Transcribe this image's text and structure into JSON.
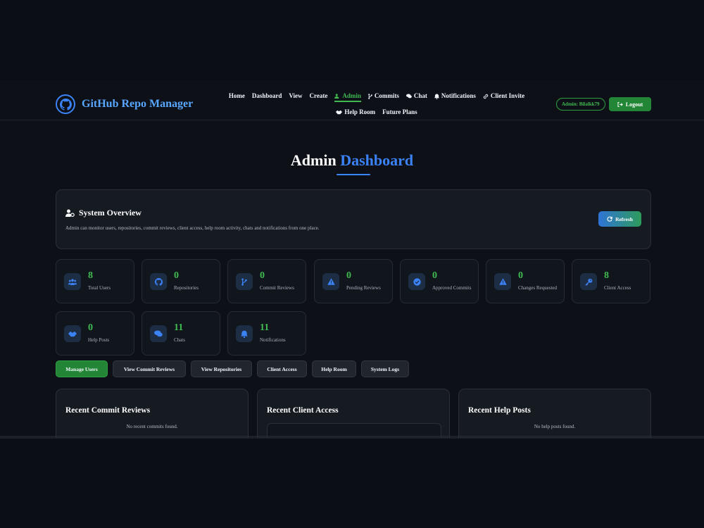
{
  "header": {
    "brand": "GitHub Repo Manager",
    "nav": [
      {
        "label": "Home",
        "icon": ""
      },
      {
        "label": "Dashboard",
        "icon": ""
      },
      {
        "label": "View",
        "icon": ""
      },
      {
        "label": "Create",
        "icon": ""
      },
      {
        "label": "Admin",
        "icon": "user-cog-icon",
        "active": true
      },
      {
        "label": "Commits",
        "icon": "branch-icon"
      },
      {
        "label": "Chat",
        "icon": "comments-icon"
      },
      {
        "label": "Notifications",
        "icon": "bell-icon"
      },
      {
        "label": "Client Invite",
        "icon": "link-icon"
      },
      {
        "label": "Help Room",
        "icon": "handshake-icon"
      },
      {
        "label": "Future Plans",
        "icon": ""
      }
    ],
    "admin_badge": "Admin: Bilalkk79",
    "logout_label": "Logout"
  },
  "page": {
    "title_main": "Admin",
    "title_accent": "Dashboard"
  },
  "overview": {
    "title": "System Overview",
    "description": "Admin can monitor users, repositories, commit reviews, client access, help room activity, chats and notifications from one place.",
    "refresh_label": "Refresh"
  },
  "stats": [
    {
      "value": "8",
      "label": "Total Users",
      "icon": "users-icon"
    },
    {
      "value": "0",
      "label": "Repositories",
      "icon": "github-icon"
    },
    {
      "value": "0",
      "label": "Commit Reviews",
      "icon": "branch-icon"
    },
    {
      "value": "0",
      "label": "Pending Reviews",
      "icon": "warning-icon"
    },
    {
      "value": "0",
      "label": "Approved Commits",
      "icon": "check-circle-icon"
    },
    {
      "value": "0",
      "label": "Changes Requested",
      "icon": "warning-icon"
    },
    {
      "value": "8",
      "label": "Client Access",
      "icon": "key-icon"
    },
    {
      "value": "0",
      "label": "Help Posts",
      "icon": "handshake-icon"
    },
    {
      "value": "11",
      "label": "Chats",
      "icon": "comments-icon"
    },
    {
      "value": "11",
      "label": "Notifications",
      "icon": "bell-icon"
    }
  ],
  "actions": [
    {
      "label": "Manage Users"
    },
    {
      "label": "View Commit Reviews"
    },
    {
      "label": "View Repositories"
    },
    {
      "label": "Client Access"
    },
    {
      "label": "Help Room"
    },
    {
      "label": "System Logs"
    }
  ],
  "panels": [
    {
      "title": "Recent Commit Reviews",
      "empty": "No recent commits found."
    },
    {
      "title": "Recent Client Access",
      "empty": ""
    },
    {
      "title": "Recent Help Posts",
      "empty": "No help posts found."
    }
  ],
  "colors": {
    "accent_blue": "#3b82f6",
    "accent_green": "#3fb950",
    "background": "#0d1117"
  }
}
